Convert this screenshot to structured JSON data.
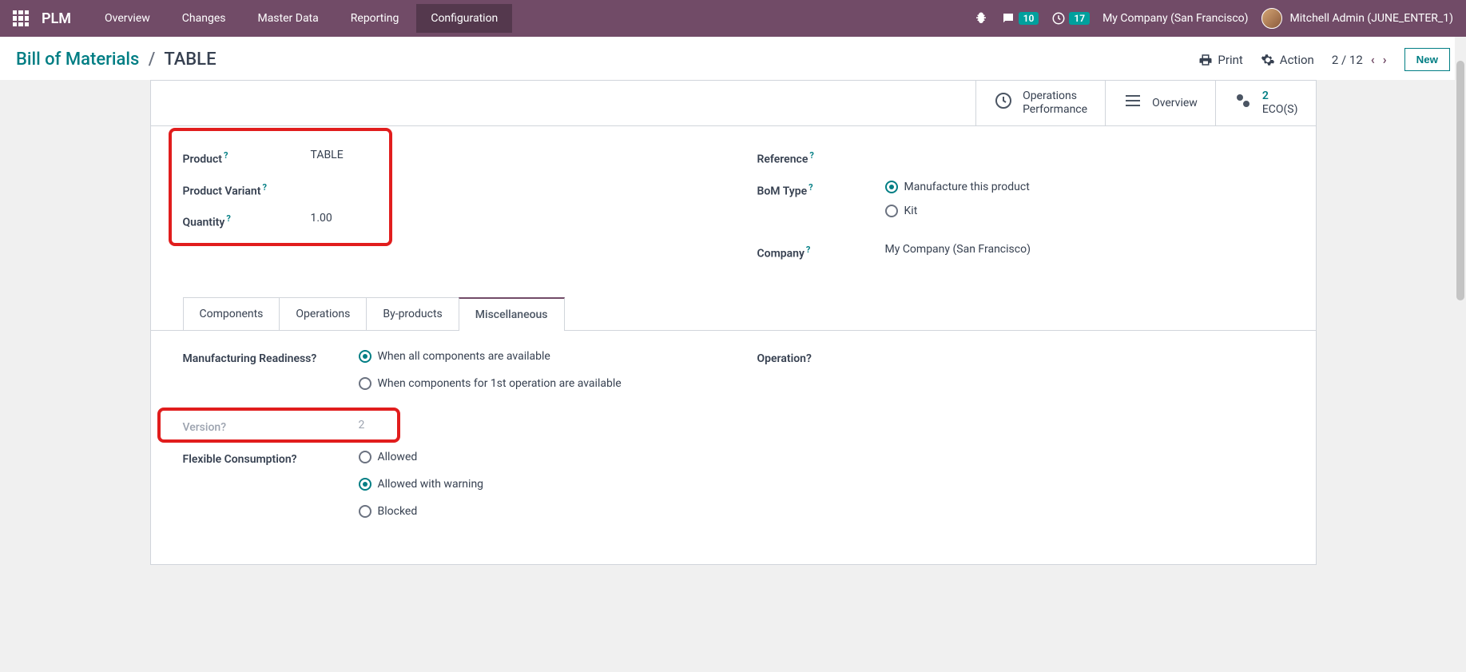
{
  "topbar": {
    "brand": "PLM",
    "nav": [
      "Overview",
      "Changes",
      "Master Data",
      "Reporting",
      "Configuration"
    ],
    "active_nav": "Configuration",
    "msg_badge": "10",
    "activity_badge": "17",
    "company": "My Company (San Francisco)",
    "user": "Mitchell Admin (JUNE_ENTER_1)"
  },
  "breadcrumb": {
    "root": "Bill of Materials",
    "leaf": "TABLE",
    "print": "Print",
    "action": "Action",
    "pager": "2 / 12",
    "new": "New"
  },
  "stats": {
    "ops_perf": "Operations\nPerformance",
    "overview": "Overview",
    "eco_count": "2",
    "eco_label": "ECO(S)"
  },
  "fields": {
    "product_label": "Product",
    "product_value": "TABLE",
    "variant_label": "Product Variant",
    "quantity_label": "Quantity",
    "quantity_value": "1.00",
    "reference_label": "Reference",
    "bom_type_label": "BoM Type",
    "bom_type_options": [
      "Manufacture this product",
      "Kit"
    ],
    "bom_type_selected": 0,
    "company_label": "Company",
    "company_value": "My Company (San Francisco)"
  },
  "tabs": [
    "Components",
    "Operations",
    "By-products",
    "Miscellaneous"
  ],
  "active_tab": 3,
  "misc": {
    "readiness_label": "Manufacturing Readiness",
    "readiness_options": [
      "When all components are available",
      "When components for 1st operation are available"
    ],
    "readiness_selected": 0,
    "version_label": "Version",
    "version_value": "2",
    "flex_label": "Flexible Consumption",
    "flex_options": [
      "Allowed",
      "Allowed with warning",
      "Blocked"
    ],
    "flex_selected": 1,
    "operation_label": "Operation"
  }
}
